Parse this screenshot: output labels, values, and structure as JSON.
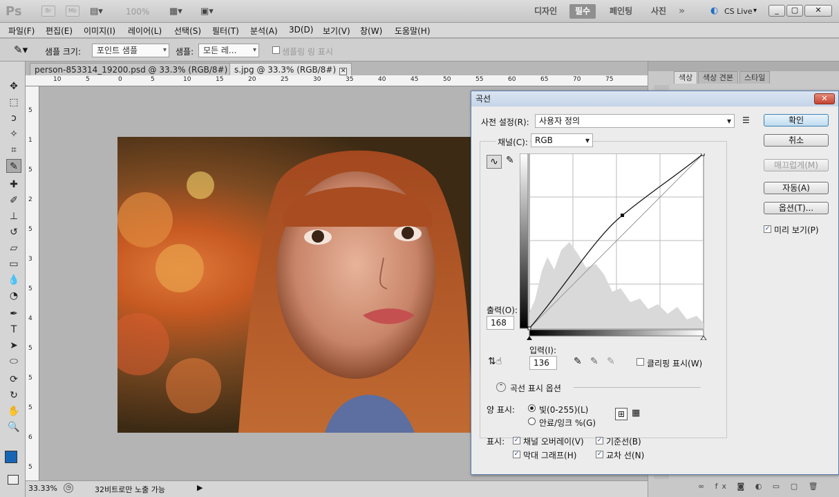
{
  "app": {
    "logo": "Ps",
    "icons": [
      "Br",
      "Mb"
    ],
    "zoom": "100%",
    "workspaces": [
      "디자인",
      "필수",
      "페인팅",
      "사진"
    ],
    "active_workspace": "필수",
    "cslive": "CS Live",
    "more": "»"
  },
  "menu": [
    "파일(F)",
    "편집(E)",
    "이미지(I)",
    "레이어(L)",
    "선택(S)",
    "필터(T)",
    "분석(A)",
    "3D(D)",
    "보기(V)",
    "창(W)",
    "도움말(H)"
  ],
  "options": {
    "sample_size_label": "샘플 크기:",
    "sample_size_value": "포인트 샘플",
    "sample_label": "샘플:",
    "sample_value": "모든 레...",
    "show_ring": "샘플링 링 표시"
  },
  "tabs": [
    {
      "label": "person-853314_19200.psd @ 33.3% (RGB/8#) *"
    },
    {
      "label": "s.jpg @ 33.3% (RGB/8#)"
    }
  ],
  "ruler_top": [
    "10",
    "5",
    "0",
    "5",
    "10",
    "15",
    "20",
    "25",
    "30",
    "35",
    "40",
    "45",
    "50",
    "55",
    "60",
    "65",
    "70",
    "75"
  ],
  "ruler_left": [
    "5",
    "1",
    "5",
    "2",
    "5",
    "3",
    "5",
    "4",
    "5",
    "5",
    "5",
    "6",
    "5"
  ],
  "status": {
    "zoom": "33.33%",
    "info": "32비트로만 노출 가능"
  },
  "panel": {
    "tabs": [
      "색상",
      "색상 견본",
      "스타일"
    ]
  },
  "dialog": {
    "title": "곡선",
    "preset_label": "사전 설정(R):",
    "preset_value": "사용자 정의",
    "channel_label": "채널(C):",
    "channel_value": "RGB",
    "output_label": "출력(O):",
    "output_value": "168",
    "input_label": "입력(I):",
    "input_value": "136",
    "clipping_label": "클리핑 표시(W)",
    "options_header": "곡선 표시 옵션",
    "amount_label": "양 표시:",
    "radio_light": "빛(0-255)(L)",
    "radio_ink": "안료/잉크 %(G)",
    "show_label": "표시:",
    "show_channel": "채널 오버레이(V)",
    "show_baseline": "기준선(B)",
    "show_histogram": "막대 그래프(H)",
    "show_intersection": "교차 선(N)",
    "buttons": {
      "ok": "확인",
      "cancel": "취소",
      "smooth": "매끄럽게(M)",
      "auto": "자동(A)",
      "options": "옵션(T)..."
    },
    "preview_label": "미리 보기(P)"
  }
}
